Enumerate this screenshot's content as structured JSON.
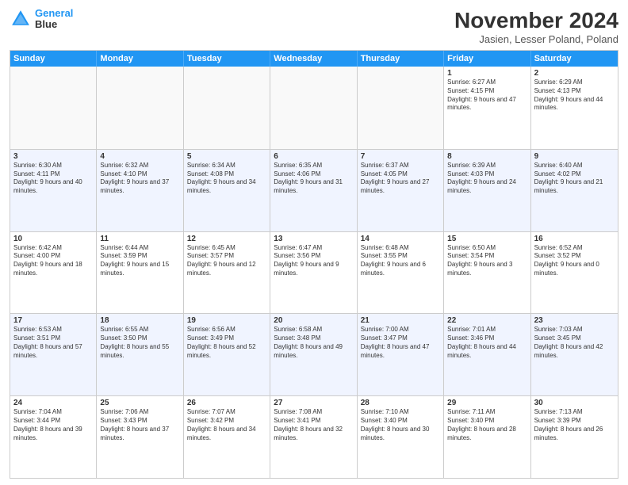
{
  "header": {
    "logo_line1": "General",
    "logo_line2": "Blue",
    "month": "November 2024",
    "location": "Jasien, Lesser Poland, Poland"
  },
  "weekdays": [
    "Sunday",
    "Monday",
    "Tuesday",
    "Wednesday",
    "Thursday",
    "Friday",
    "Saturday"
  ],
  "rows": [
    [
      {
        "day": "",
        "info": "",
        "empty": true
      },
      {
        "day": "",
        "info": "",
        "empty": true
      },
      {
        "day": "",
        "info": "",
        "empty": true
      },
      {
        "day": "",
        "info": "",
        "empty": true
      },
      {
        "day": "",
        "info": "",
        "empty": true
      },
      {
        "day": "1",
        "info": "Sunrise: 6:27 AM\nSunset: 4:15 PM\nDaylight: 9 hours and 47 minutes."
      },
      {
        "day": "2",
        "info": "Sunrise: 6:29 AM\nSunset: 4:13 PM\nDaylight: 9 hours and 44 minutes."
      }
    ],
    [
      {
        "day": "3",
        "info": "Sunrise: 6:30 AM\nSunset: 4:11 PM\nDaylight: 9 hours and 40 minutes."
      },
      {
        "day": "4",
        "info": "Sunrise: 6:32 AM\nSunset: 4:10 PM\nDaylight: 9 hours and 37 minutes."
      },
      {
        "day": "5",
        "info": "Sunrise: 6:34 AM\nSunset: 4:08 PM\nDaylight: 9 hours and 34 minutes."
      },
      {
        "day": "6",
        "info": "Sunrise: 6:35 AM\nSunset: 4:06 PM\nDaylight: 9 hours and 31 minutes."
      },
      {
        "day": "7",
        "info": "Sunrise: 6:37 AM\nSunset: 4:05 PM\nDaylight: 9 hours and 27 minutes."
      },
      {
        "day": "8",
        "info": "Sunrise: 6:39 AM\nSunset: 4:03 PM\nDaylight: 9 hours and 24 minutes."
      },
      {
        "day": "9",
        "info": "Sunrise: 6:40 AM\nSunset: 4:02 PM\nDaylight: 9 hours and 21 minutes."
      }
    ],
    [
      {
        "day": "10",
        "info": "Sunrise: 6:42 AM\nSunset: 4:00 PM\nDaylight: 9 hours and 18 minutes."
      },
      {
        "day": "11",
        "info": "Sunrise: 6:44 AM\nSunset: 3:59 PM\nDaylight: 9 hours and 15 minutes."
      },
      {
        "day": "12",
        "info": "Sunrise: 6:45 AM\nSunset: 3:57 PM\nDaylight: 9 hours and 12 minutes."
      },
      {
        "day": "13",
        "info": "Sunrise: 6:47 AM\nSunset: 3:56 PM\nDaylight: 9 hours and 9 minutes."
      },
      {
        "day": "14",
        "info": "Sunrise: 6:48 AM\nSunset: 3:55 PM\nDaylight: 9 hours and 6 minutes."
      },
      {
        "day": "15",
        "info": "Sunrise: 6:50 AM\nSunset: 3:54 PM\nDaylight: 9 hours and 3 minutes."
      },
      {
        "day": "16",
        "info": "Sunrise: 6:52 AM\nSunset: 3:52 PM\nDaylight: 9 hours and 0 minutes."
      }
    ],
    [
      {
        "day": "17",
        "info": "Sunrise: 6:53 AM\nSunset: 3:51 PM\nDaylight: 8 hours and 57 minutes."
      },
      {
        "day": "18",
        "info": "Sunrise: 6:55 AM\nSunset: 3:50 PM\nDaylight: 8 hours and 55 minutes."
      },
      {
        "day": "19",
        "info": "Sunrise: 6:56 AM\nSunset: 3:49 PM\nDaylight: 8 hours and 52 minutes."
      },
      {
        "day": "20",
        "info": "Sunrise: 6:58 AM\nSunset: 3:48 PM\nDaylight: 8 hours and 49 minutes."
      },
      {
        "day": "21",
        "info": "Sunrise: 7:00 AM\nSunset: 3:47 PM\nDaylight: 8 hours and 47 minutes."
      },
      {
        "day": "22",
        "info": "Sunrise: 7:01 AM\nSunset: 3:46 PM\nDaylight: 8 hours and 44 minutes."
      },
      {
        "day": "23",
        "info": "Sunrise: 7:03 AM\nSunset: 3:45 PM\nDaylight: 8 hours and 42 minutes."
      }
    ],
    [
      {
        "day": "24",
        "info": "Sunrise: 7:04 AM\nSunset: 3:44 PM\nDaylight: 8 hours and 39 minutes."
      },
      {
        "day": "25",
        "info": "Sunrise: 7:06 AM\nSunset: 3:43 PM\nDaylight: 8 hours and 37 minutes."
      },
      {
        "day": "26",
        "info": "Sunrise: 7:07 AM\nSunset: 3:42 PM\nDaylight: 8 hours and 34 minutes."
      },
      {
        "day": "27",
        "info": "Sunrise: 7:08 AM\nSunset: 3:41 PM\nDaylight: 8 hours and 32 minutes."
      },
      {
        "day": "28",
        "info": "Sunrise: 7:10 AM\nSunset: 3:40 PM\nDaylight: 8 hours and 30 minutes."
      },
      {
        "day": "29",
        "info": "Sunrise: 7:11 AM\nSunset: 3:40 PM\nDaylight: 8 hours and 28 minutes."
      },
      {
        "day": "30",
        "info": "Sunrise: 7:13 AM\nSunset: 3:39 PM\nDaylight: 8 hours and 26 minutes."
      }
    ]
  ]
}
